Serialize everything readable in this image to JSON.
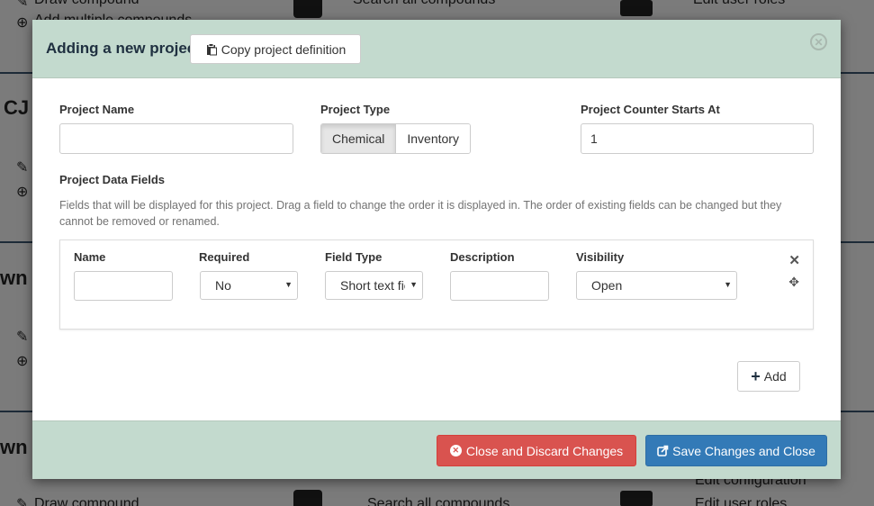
{
  "background": {
    "top_items": [
      "Draw compound",
      "Search all compounds",
      "Edit user roles",
      "Add multiple compounds"
    ],
    "headings": [
      "CJ",
      "wn",
      "wn"
    ],
    "bottom_items": [
      "Edit configuration",
      "Draw compound",
      "Search all compounds",
      "Edit user roles"
    ]
  },
  "modal": {
    "title": "Adding a new project",
    "copy_button": "Copy project definition",
    "project_name_label": "Project Name",
    "project_name_value": "",
    "project_type_label": "Project Type",
    "project_type_options": [
      "Chemical",
      "Inventory"
    ],
    "project_type_selected": "Chemical",
    "counter_label": "Project Counter Starts At",
    "counter_value": "1",
    "data_fields_label": "Project Data Fields",
    "data_fields_help": "Fields that will be displayed for this project. Drag a field to change the order it is displayed in. The order of existing fields can be changed but they cannot be removed or renamed.",
    "field_columns": {
      "name": "Name",
      "required": "Required",
      "field_type": "Field Type",
      "description": "Description",
      "visibility": "Visibility"
    },
    "field_row": {
      "name": "",
      "required": "No",
      "field_type": "Short text field",
      "description": "",
      "visibility": "Open"
    },
    "add_button": "Add",
    "discard_button": "Close and Discard Changes",
    "save_button": "Save Changes and Close"
  },
  "colors": {
    "header_bg": "#c3dace",
    "danger": "#d9534f",
    "primary": "#337ab7",
    "overlay": "#7b7b7b"
  },
  "icons": [
    "clipboard-icon",
    "close-circle-icon",
    "remove-icon",
    "move-icon",
    "plus-icon",
    "circle-x-icon",
    "share-icon",
    "pencil-icon",
    "plus-circle-icon",
    "search-icon",
    "user-icon",
    "trash-icon",
    "camera-icon",
    "drive-icon"
  ]
}
